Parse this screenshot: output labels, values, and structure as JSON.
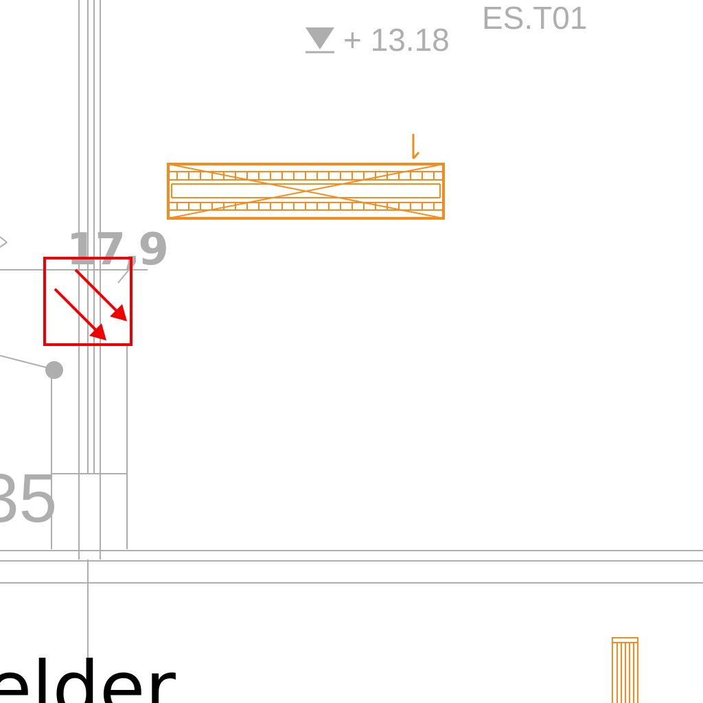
{
  "drawing": {
    "elevation_marker": {
      "text": "+ 13.18",
      "icon": "level-triangle-icon"
    },
    "sheet_tag": "ES.T01",
    "dimension_label": "17,9",
    "partial_number": "35",
    "partial_word": "elder",
    "colors": {
      "line": "#aeaeae",
      "highlight": "#ee0000",
      "element": "#f28c1e",
      "text": "#000000"
    },
    "symbols": {
      "highlight_box": "diagonal-arrows-icon",
      "orange_element": "hatched-beam-icon",
      "small_element": "hatched-column-icon"
    }
  }
}
